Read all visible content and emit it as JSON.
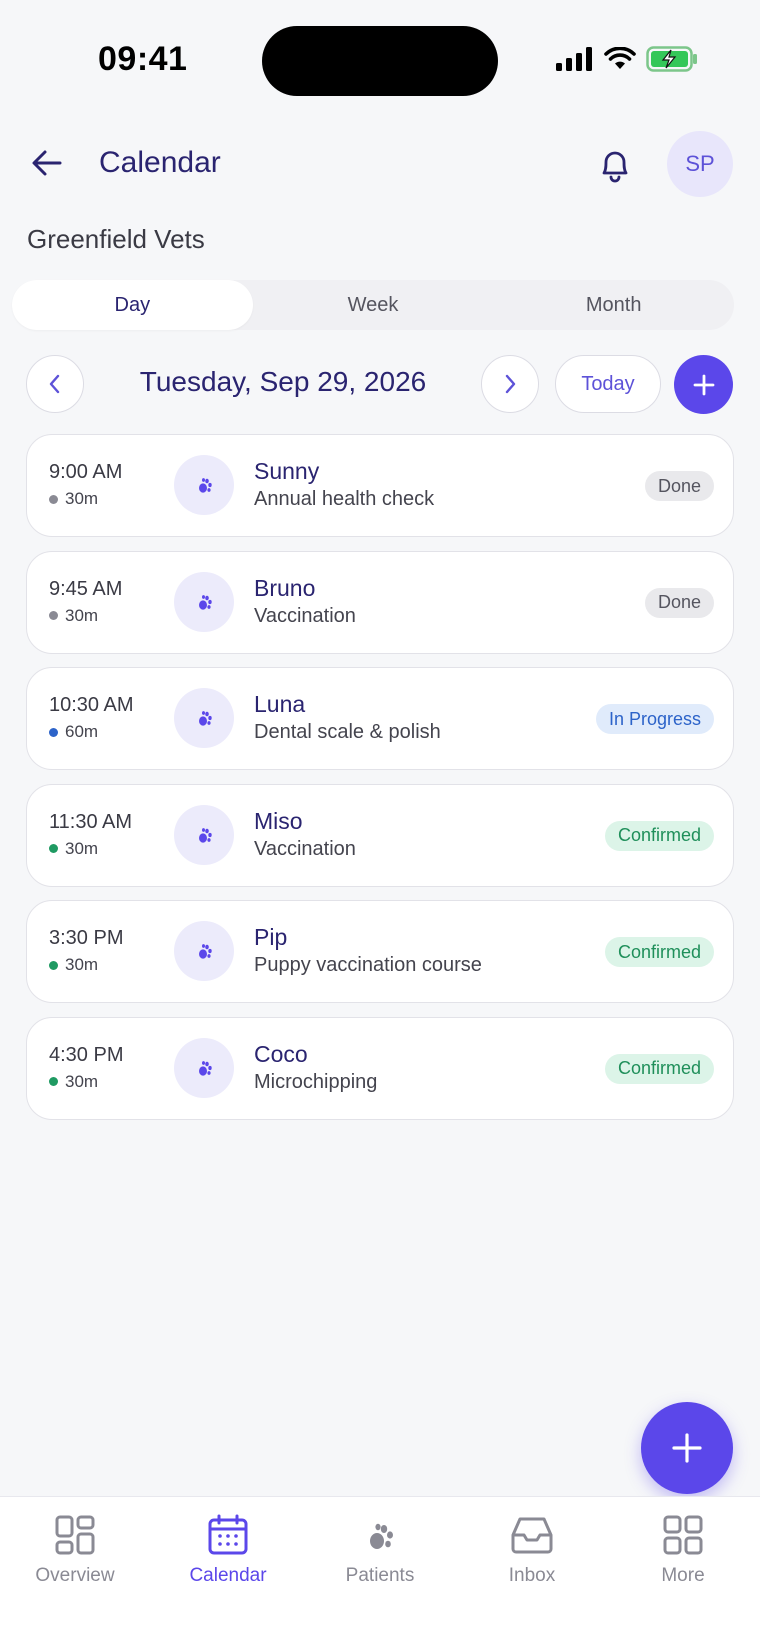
{
  "status_bar": {
    "time": "09:41"
  },
  "header": {
    "title": "Calendar",
    "avatar_initials": "SP"
  },
  "clinic": {
    "name": "Greenfield Vets"
  },
  "view_tabs": [
    {
      "label": "Day",
      "active": true
    },
    {
      "label": "Week",
      "active": false
    },
    {
      "label": "Month",
      "active": false
    }
  ],
  "date_nav": {
    "date": "Tuesday, Sep 29, 2026",
    "today_label": "Today"
  },
  "appointments": [
    {
      "time": "9:00 AM",
      "duration": "30m",
      "dot_color": "#8a8a94",
      "pet": "Sunny",
      "service": "Annual health check",
      "status": "Done",
      "status_type": "done"
    },
    {
      "time": "9:45 AM",
      "duration": "30m",
      "dot_color": "#8a8a94",
      "pet": "Bruno",
      "service": "Vaccination",
      "status": "Done",
      "status_type": "done"
    },
    {
      "time": "10:30 AM",
      "duration": "60m",
      "dot_color": "#2c63c9",
      "pet": "Luna",
      "service": "Dental scale & polish",
      "status": "In Progress",
      "status_type": "progress"
    },
    {
      "time": "11:30 AM",
      "duration": "30m",
      "dot_color": "#1f9a62",
      "pet": "Miso",
      "service": "Vaccination",
      "status": "Confirmed",
      "status_type": "confirmed"
    },
    {
      "time": "3:30 PM",
      "duration": "30m",
      "dot_color": "#1f9a62",
      "pet": "Pip",
      "service": "Puppy vaccination course",
      "status": "Confirmed",
      "status_type": "confirmed"
    },
    {
      "time": "4:30 PM",
      "duration": "30m",
      "dot_color": "#1f9a62",
      "pet": "Coco",
      "service": "Microchipping",
      "status": "Confirmed",
      "status_type": "confirmed"
    }
  ],
  "tab_bar": [
    {
      "label": "Overview",
      "icon": "grid-icon",
      "active": false
    },
    {
      "label": "Calendar",
      "icon": "calendar-icon",
      "active": true
    },
    {
      "label": "Patients",
      "icon": "paw-icon",
      "active": false
    },
    {
      "label": "Inbox",
      "icon": "inbox-icon",
      "active": false
    },
    {
      "label": "More",
      "icon": "more-grid-icon",
      "active": false
    }
  ],
  "colors": {
    "accent": "#5b47ea",
    "title": "#2a2470",
    "background": "#f6f7f9"
  }
}
